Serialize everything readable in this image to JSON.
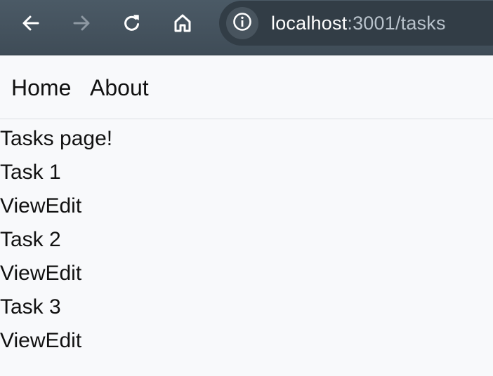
{
  "browser": {
    "url_host": "localhost",
    "url_path": ":3001/tasks",
    "back_icon": "arrow-left-icon",
    "forward_icon": "arrow-right-icon",
    "reload_icon": "reload-icon",
    "home_icon": "home-icon",
    "site_info_icon": "info-circle-icon"
  },
  "nav": {
    "home_label": "Home",
    "about_label": "About"
  },
  "page": {
    "heading": "Tasks page!",
    "tasks": [
      {
        "title": "Task 1",
        "view_label": "View",
        "edit_label": "Edit"
      },
      {
        "title": "Task 2",
        "view_label": "View",
        "edit_label": "Edit"
      },
      {
        "title": "Task 3",
        "view_label": "View",
        "edit_label": "Edit"
      }
    ]
  },
  "colors": {
    "toolbar_bg": "#45535e",
    "page_bg": "#f8f9fb",
    "text": "#111111",
    "url_host": "#ffffff",
    "url_path": "#b8c2cb"
  }
}
